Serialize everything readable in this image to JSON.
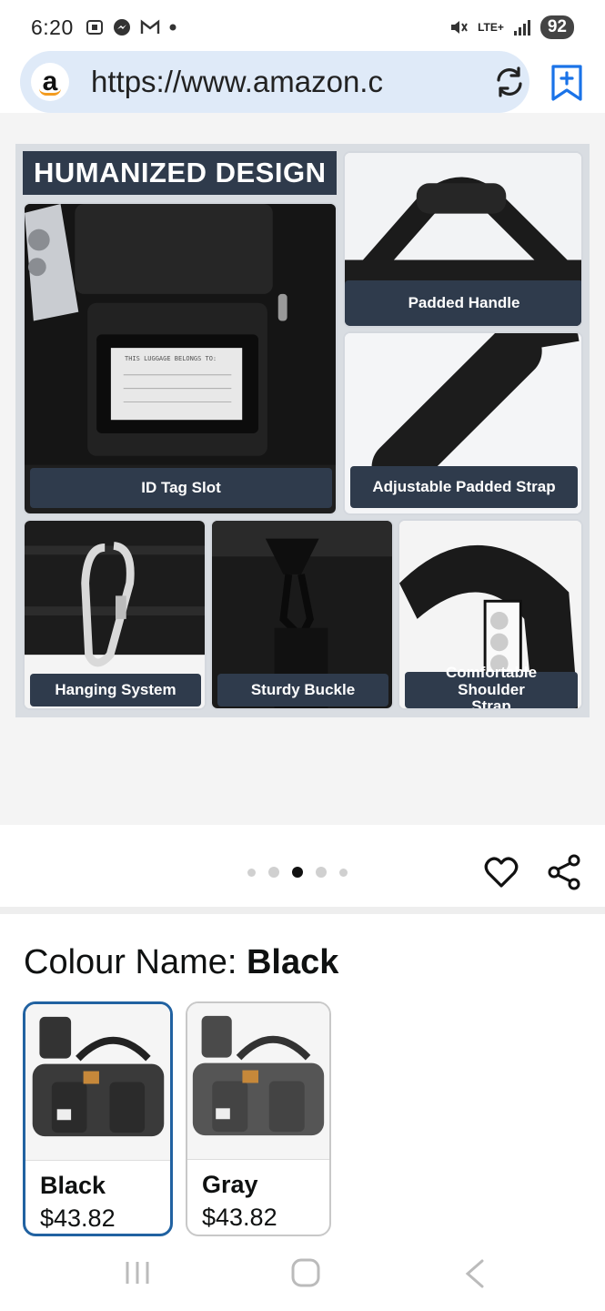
{
  "status_bar": {
    "time": "6:20",
    "network": "LTE+",
    "battery": "92"
  },
  "browser": {
    "url": "https://www.amazon.c",
    "logo_letter": "a",
    "icons": [
      "amazon-logo-icon",
      "reload-icon",
      "bookmark-add-icon"
    ]
  },
  "infographic": {
    "banner": "HUMANIZED DESIGN",
    "labels": {
      "id_tag": "ID Tag Slot",
      "padded_handle": "Padded Handle",
      "adjustable_strap": "Adjustable Padded Strap",
      "hanging_system": "Hanging System",
      "sturdy_buckle": "Sturdy Buckle",
      "comfortable_strap": "Comfortable Shoulder Strap"
    },
    "tag_text": "THIS LUGGAGE BELONGS TO:"
  },
  "carousel": {
    "total": 5,
    "active_index": 2
  },
  "actions": {
    "icons": [
      "heart-icon",
      "share-icon"
    ]
  },
  "colour": {
    "label": "Colour Name: ",
    "selected": "Black",
    "options": [
      {
        "name": "Black",
        "price": "$43.82",
        "selected": true
      },
      {
        "name": "Gray",
        "price": "$43.82",
        "selected": false
      }
    ]
  },
  "colors": {
    "accent": "#2162a1",
    "label_bg": "#2f3b4c",
    "url_bar": "#dfeaf8"
  }
}
